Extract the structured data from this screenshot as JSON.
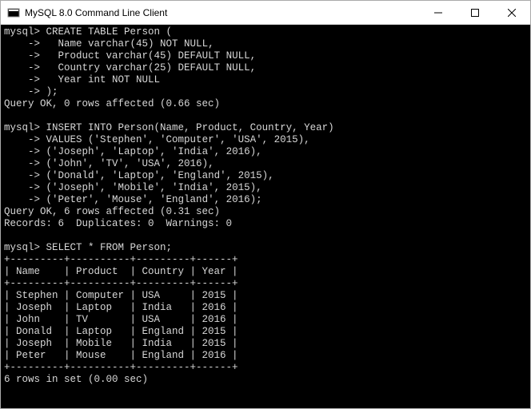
{
  "window": {
    "title": "MySQL 8.0 Command Line Client"
  },
  "terminal": {
    "prompt": "mysql>",
    "cont": "    ->",
    "create_table": {
      "line1": "CREATE TABLE Person (",
      "line2": "  Name varchar(45) NOT NULL,",
      "line3": "  Product varchar(45) DEFAULT NULL,",
      "line4": "  Country varchar(25) DEFAULT NULL,",
      "line5": "  Year int NOT NULL",
      "line6": ");",
      "result": "Query OK, 0 rows affected (0.66 sec)"
    },
    "insert": {
      "line1": "INSERT INTO Person(Name, Product, Country, Year)",
      "line2": "VALUES ('Stephen', 'Computer', 'USA', 2015),",
      "line3": "('Joseph', 'Laptop', 'India', 2016),",
      "line4": "('John', 'TV', 'USA', 2016),",
      "line5": "('Donald', 'Laptop', 'England', 2015),",
      "line6": "('Joseph', 'Mobile', 'India', 2015),",
      "line7": "('Peter', 'Mouse', 'England', 2016);",
      "result1": "Query OK, 6 rows affected (0.31 sec)",
      "result2": "Records: 6  Duplicates: 0  Warnings: 0"
    },
    "select": {
      "query": "SELECT * FROM Person;",
      "sep": "+---------+----------+---------+------+",
      "header": "| Name    | Product  | Country | Year |",
      "rows": [
        "| Stephen | Computer | USA     | 2015 |",
        "| Joseph  | Laptop   | India   | 2016 |",
        "| John    | TV       | USA     | 2016 |",
        "| Donald  | Laptop   | England | 2015 |",
        "| Joseph  | Mobile   | India   | 2015 |",
        "| Peter   | Mouse    | England | 2016 |"
      ],
      "footer": "6 rows in set (0.00 sec)"
    }
  },
  "chart_data": {
    "type": "table",
    "title": "Person",
    "columns": [
      "Name",
      "Product",
      "Country",
      "Year"
    ],
    "rows": [
      [
        "Stephen",
        "Computer",
        "USA",
        2015
      ],
      [
        "Joseph",
        "Laptop",
        "India",
        2016
      ],
      [
        "John",
        "TV",
        "USA",
        2016
      ],
      [
        "Donald",
        "Laptop",
        "England",
        2015
      ],
      [
        "Joseph",
        "Mobile",
        "India",
        2015
      ],
      [
        "Peter",
        "Mouse",
        "England",
        2016
      ]
    ]
  }
}
